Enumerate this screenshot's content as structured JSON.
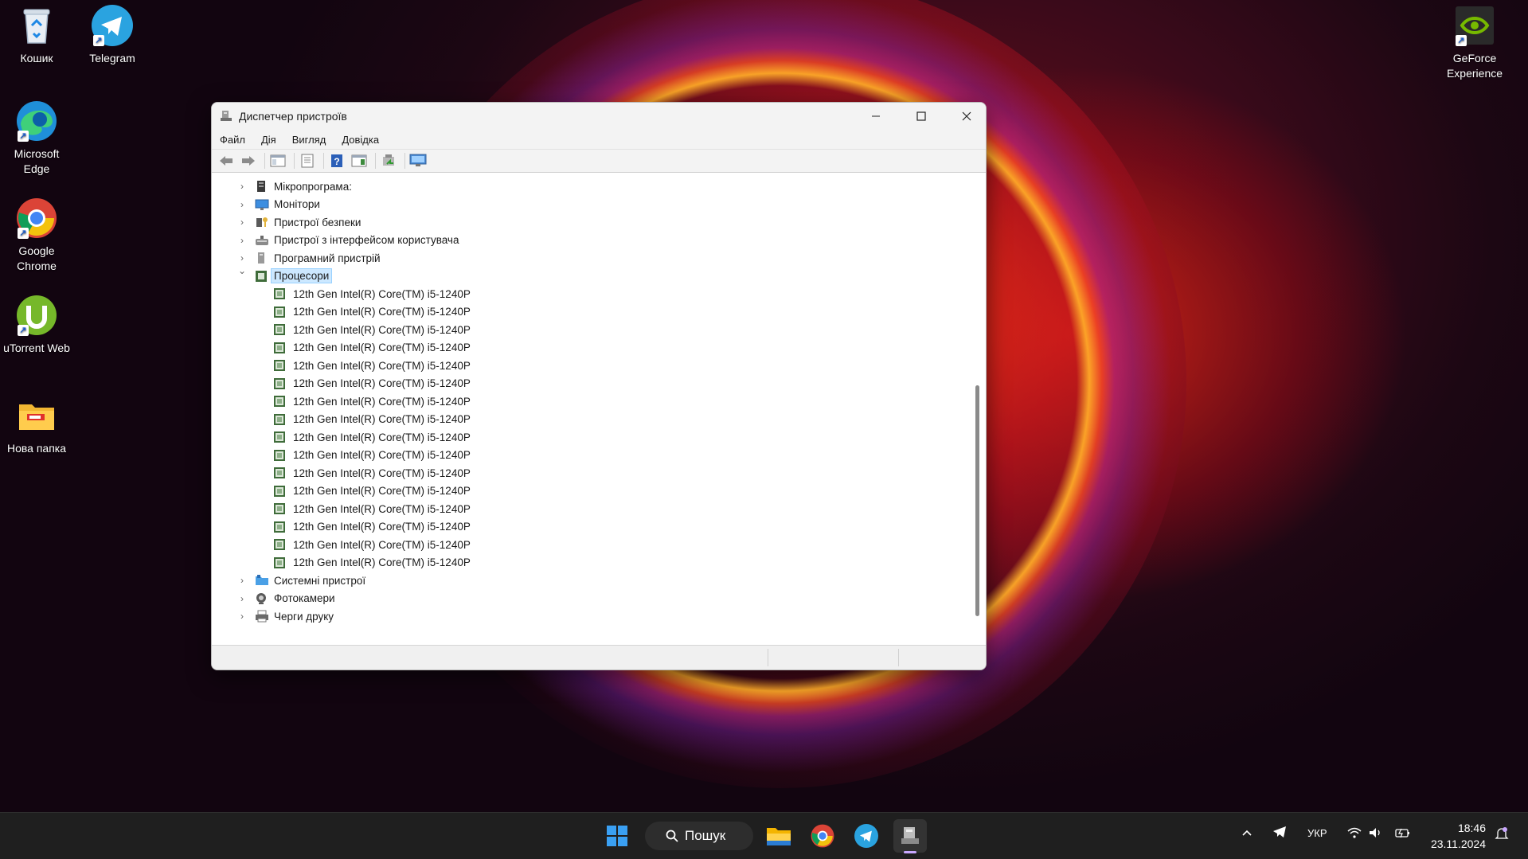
{
  "desktop": {
    "icons": [
      {
        "label": "Кошик"
      },
      {
        "label": "Telegram"
      },
      {
        "label": "Microsoft Edge"
      },
      {
        "label": "Google Chrome"
      },
      {
        "label": "uTorrent Web"
      },
      {
        "label": "Нова папка"
      },
      {
        "label": "GeForce Experience"
      }
    ]
  },
  "window": {
    "title": "Диспетчер пристроїв",
    "menu": [
      "Файл",
      "Дія",
      "Вигляд",
      "Довідка"
    ],
    "tree": {
      "categories_before": [
        {
          "label": "Мікропрограма:",
          "icon": "firmware-icon"
        },
        {
          "label": "Монітори",
          "icon": "monitor-icon"
        },
        {
          "label": "Пристрої безпеки",
          "icon": "security-devices-icon"
        },
        {
          "label": "Пристрої з інтерфейсом користувача",
          "icon": "hid-icon"
        },
        {
          "label": "Програмний пристрій",
          "icon": "software-device-icon"
        }
      ],
      "expanded_category": {
        "label": "Процесори",
        "icon": "processor-icon",
        "selected": true
      },
      "processors": [
        "12th Gen Intel(R) Core(TM) i5-1240P",
        "12th Gen Intel(R) Core(TM) i5-1240P",
        "12th Gen Intel(R) Core(TM) i5-1240P",
        "12th Gen Intel(R) Core(TM) i5-1240P",
        "12th Gen Intel(R) Core(TM) i5-1240P",
        "12th Gen Intel(R) Core(TM) i5-1240P",
        "12th Gen Intel(R) Core(TM) i5-1240P",
        "12th Gen Intel(R) Core(TM) i5-1240P",
        "12th Gen Intel(R) Core(TM) i5-1240P",
        "12th Gen Intel(R) Core(TM) i5-1240P",
        "12th Gen Intel(R) Core(TM) i5-1240P",
        "12th Gen Intel(R) Core(TM) i5-1240P",
        "12th Gen Intel(R) Core(TM) i5-1240P",
        "12th Gen Intel(R) Core(TM) i5-1240P",
        "12th Gen Intel(R) Core(TM) i5-1240P",
        "12th Gen Intel(R) Core(TM) i5-1240P"
      ],
      "categories_after": [
        {
          "label": "Системні пристрої",
          "icon": "system-devices-icon"
        },
        {
          "label": "Фотокамери",
          "icon": "camera-icon"
        },
        {
          "label": "Черги друку",
          "icon": "print-queue-icon"
        }
      ]
    }
  },
  "taskbar": {
    "search_label": "Пошук",
    "language": "УКР",
    "time": "18:46",
    "date": "23.11.2024"
  },
  "colors": {
    "selection": "#cce8ff",
    "selection_border": "#99d1ff",
    "taskbar_bg": "#1f1f1f"
  }
}
